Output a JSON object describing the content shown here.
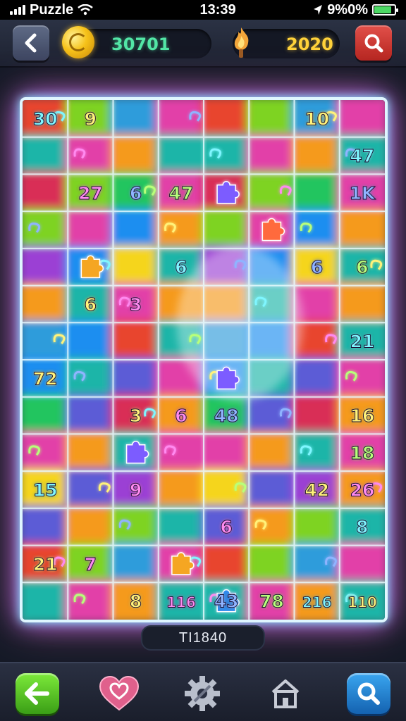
{
  "status_bar": {
    "app_name": "Puzzle",
    "time": "13:39",
    "battery": "9%0%"
  },
  "header": {
    "coins": "30701",
    "score": "2020",
    "back_icon": "chevron-left-icon",
    "search_icon": "search-icon"
  },
  "board": {
    "rows": 14,
    "cols": 8,
    "cells": [
      [
        "30",
        "9",
        "",
        "",
        "",
        "",
        "10",
        ""
      ],
      [
        "",
        "",
        "",
        "",
        "",
        "",
        "",
        "47"
      ],
      [
        "",
        "27",
        "6",
        "47",
        "",
        "",
        "",
        "1K"
      ],
      [
        "",
        "",
        "",
        "",
        "",
        "",
        "",
        ""
      ],
      [
        "",
        "",
        "",
        "6",
        "",
        "",
        "6",
        "6"
      ],
      [
        "",
        "6",
        "3",
        "",
        "",
        "",
        "",
        ""
      ],
      [
        "",
        "",
        "",
        "",
        "",
        "",
        "",
        "21"
      ],
      [
        "72",
        "",
        "",
        "",
        "",
        "",
        "",
        ""
      ],
      [
        "",
        "",
        "3",
        "6",
        "48",
        "",
        "",
        "16"
      ],
      [
        "",
        "",
        "",
        "",
        "",
        "",
        "",
        "18"
      ],
      [
        "15",
        "",
        "9",
        "",
        "",
        "",
        "42",
        "26"
      ],
      [
        "",
        "",
        "",
        "",
        "6",
        "",
        "",
        "8"
      ],
      [
        "21",
        "7",
        "",
        "",
        "",
        "",
        "",
        ""
      ],
      [
        "",
        "",
        "8",
        "116",
        "43",
        "78",
        "216",
        "110"
      ]
    ],
    "number_color_key": [
      "cyan",
      "yellow",
      "magenta",
      "blue"
    ]
  },
  "level_label": "TI1840",
  "bottom_nav": {
    "back_icon": "arrow-left-icon",
    "favorites_icon": "heart-icon",
    "settings_icon": "gear-icon",
    "home_icon": "home-icon",
    "search_icon": "search-icon"
  },
  "colors": {
    "accent_green": "#52e6a6",
    "accent_yellow": "#ffd23a",
    "frame_glow": "#7ff0ff"
  }
}
